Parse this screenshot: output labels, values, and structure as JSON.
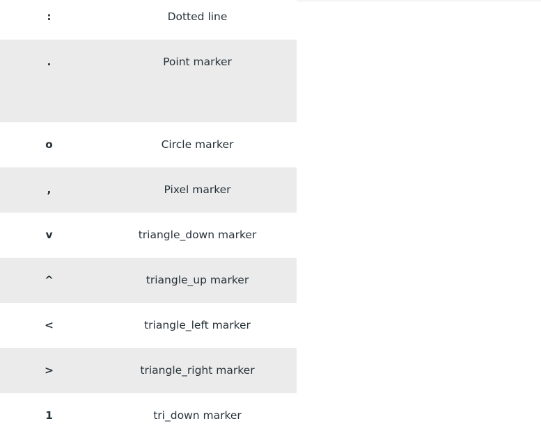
{
  "rows": [
    {
      "char": ":",
      "desc": "Dotted line",
      "shade": "white"
    },
    {
      "char": ".",
      "desc": "Point marker",
      "shade": "gray"
    },
    {
      "char": "o",
      "desc": "Circle marker",
      "shade": "white"
    },
    {
      "char": ",",
      "desc": "Pixel marker",
      "shade": "gray"
    },
    {
      "char": "v",
      "desc": "triangle_down marker",
      "shade": "white"
    },
    {
      "char": "^",
      "desc": "triangle_up marker",
      "shade": "gray"
    },
    {
      "char": "<",
      "desc": "triangle_left marker",
      "shade": "white"
    },
    {
      "char": ">",
      "desc": "triangle_right marker",
      "shade": "gray"
    },
    {
      "char": "1",
      "desc": "tri_down marker",
      "shade": "white"
    }
  ],
  "colors": {
    "text": "#273239",
    "stripe": "#ebebeb",
    "background": "#ffffff"
  }
}
